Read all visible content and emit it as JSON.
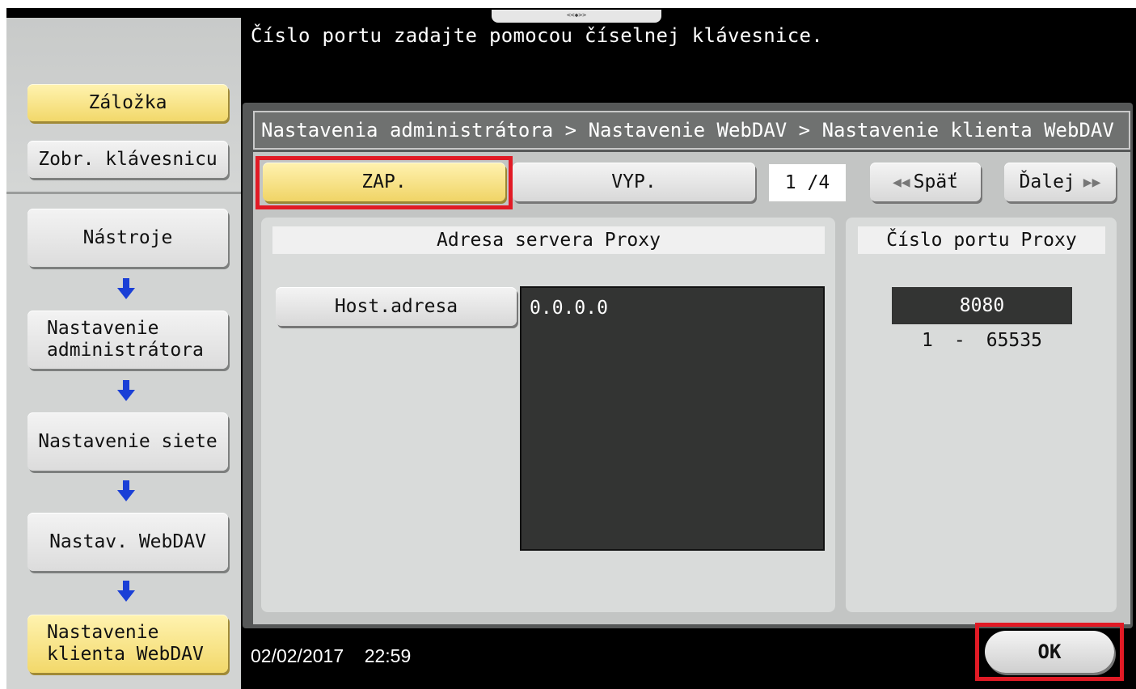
{
  "header": {
    "instruction": "Číslo portu zadajte pomocou číselnej klávesnice.",
    "handle_label": "<<◆>>"
  },
  "sidebar": {
    "bookmark_label": "Záložka",
    "keyboard_label": "Zobr. klávesnicu",
    "path": [
      {
        "label": "Nástroje"
      },
      {
        "label": "Nastavenie\nadministrátora"
      },
      {
        "label": "Nastavenie siete"
      },
      {
        "label": "Nastav. WebDAV"
      },
      {
        "label": "Nastavenie\nklienta WebDAV"
      }
    ],
    "arrow_color": "#1a3fd6"
  },
  "breadcrumb": "Nastavenia administrátora > Nastavenie WebDAV > Nastavenie klienta WebDAV",
  "toggle": {
    "on_label": "ZAP.",
    "off_label": "VYP.",
    "selected": "ZAP."
  },
  "pagination": {
    "indicator": "1 /4",
    "back_label": "Späť",
    "next_label": "Ďalej"
  },
  "proxy_address": {
    "header": "Adresa servera Proxy",
    "host_button_label": "Host.adresa",
    "value": "0.0.0.0"
  },
  "proxy_port": {
    "header": "Číslo portu Proxy",
    "value": "8080",
    "range_min": "1",
    "range_sep": "-",
    "range_max": "65535"
  },
  "footer": {
    "date": "02/02/2017",
    "time": "22:59",
    "ok_label": "OK"
  },
  "colors": {
    "highlight": "#e11a25",
    "selected_button": "#f0d466"
  }
}
